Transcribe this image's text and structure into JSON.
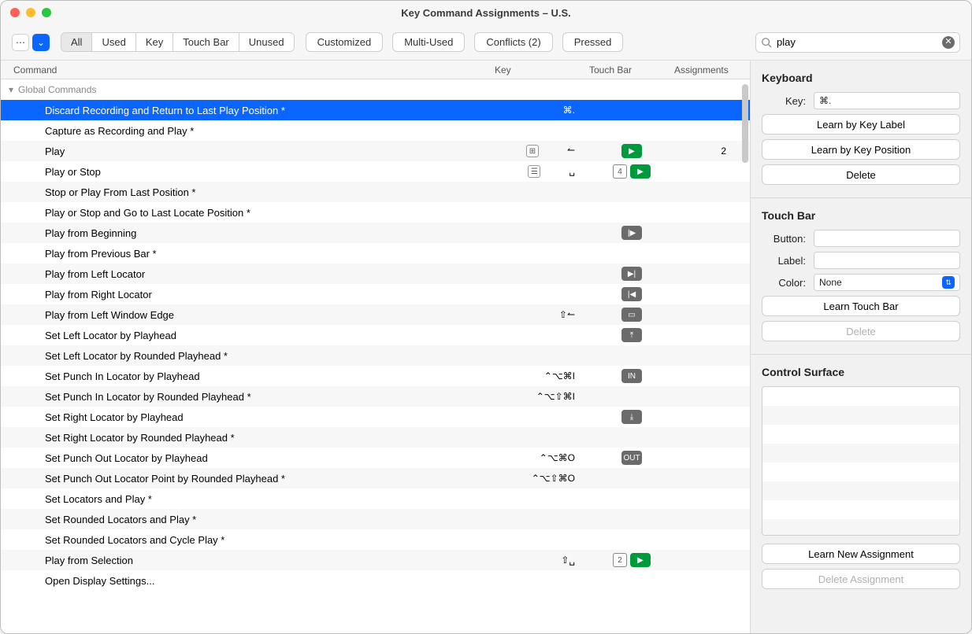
{
  "window": {
    "title": "Key Command Assignments – U.S."
  },
  "toolbar": {
    "segments": [
      "All",
      "Used",
      "Key",
      "Touch Bar",
      "Unused"
    ],
    "pills": [
      "Customized",
      "Multi-Used",
      "Conflicts (2)",
      "Pressed"
    ]
  },
  "search": {
    "value": "play",
    "placeholder": ""
  },
  "headers": {
    "command": "Command",
    "key": "Key",
    "touchbar": "Touch Bar",
    "assignments": "Assignments"
  },
  "group": {
    "label": "Global Commands"
  },
  "rows": [
    {
      "cmd": "Discard Recording and Return to Last Play Position *",
      "key": "⌘.",
      "tb": [],
      "asg": "",
      "selected": true
    },
    {
      "cmd": "Capture as Recording and Play *",
      "key": "",
      "tb": [],
      "asg": ""
    },
    {
      "cmd": "Play",
      "key": "⊞",
      "key_arrow": "↼",
      "tb": [
        {
          "t": "green",
          "g": "▶"
        }
      ],
      "asg": "2"
    },
    {
      "cmd": "Play or Stop",
      "key": "☰",
      "key_arrow": "␣",
      "tb": [
        {
          "t": "box",
          "g": "4"
        },
        {
          "t": "green",
          "g": "▶"
        }
      ],
      "asg": ""
    },
    {
      "cmd": "Stop or Play From Last Position *",
      "key": "",
      "tb": [],
      "asg": ""
    },
    {
      "cmd": "Play or Stop and Go to Last Locate Position *",
      "key": "",
      "tb": [],
      "asg": ""
    },
    {
      "cmd": "Play from Beginning",
      "key": "",
      "tb": [
        {
          "t": "gray",
          "g": "|▶"
        }
      ],
      "asg": ""
    },
    {
      "cmd": "Play from Previous Bar *",
      "key": "",
      "tb": [],
      "asg": ""
    },
    {
      "cmd": "Play from Left Locator",
      "key": "",
      "tb": [
        {
          "t": "gray",
          "g": "▶|"
        }
      ],
      "asg": ""
    },
    {
      "cmd": "Play from Right Locator",
      "key": "",
      "tb": [
        {
          "t": "gray",
          "g": "|◀"
        }
      ],
      "asg": ""
    },
    {
      "cmd": "Play from Left Window Edge",
      "key": "⇧↼",
      "tb": [
        {
          "t": "gray",
          "g": "▭"
        }
      ],
      "asg": ""
    },
    {
      "cmd": "Set Left Locator by Playhead",
      "key": "",
      "tb": [
        {
          "t": "gray",
          "g": "⤒"
        }
      ],
      "asg": ""
    },
    {
      "cmd": "Set Left Locator by Rounded Playhead *",
      "key": "",
      "tb": [],
      "asg": ""
    },
    {
      "cmd": "Set Punch In Locator by Playhead",
      "key": "⌃⌥⌘I",
      "tb": [
        {
          "t": "gray",
          "g": "IN"
        }
      ],
      "asg": ""
    },
    {
      "cmd": "Set Punch In Locator by Rounded Playhead *",
      "key": "⌃⌥⇧⌘I",
      "tb": [],
      "asg": ""
    },
    {
      "cmd": "Set Right Locator by Playhead",
      "key": "",
      "tb": [
        {
          "t": "gray",
          "g": "⤓"
        }
      ],
      "asg": ""
    },
    {
      "cmd": "Set Right Locator by Rounded Playhead *",
      "key": "",
      "tb": [],
      "asg": ""
    },
    {
      "cmd": "Set Punch Out Locator by Playhead",
      "key": "⌃⌥⌘O",
      "tb": [
        {
          "t": "gray",
          "g": "OUT"
        }
      ],
      "asg": ""
    },
    {
      "cmd": "Set Punch Out Locator Point by Rounded Playhead *",
      "key": "⌃⌥⇧⌘O",
      "tb": [],
      "asg": ""
    },
    {
      "cmd": "Set Locators and Play *",
      "key": "",
      "tb": [],
      "asg": ""
    },
    {
      "cmd": "Set Rounded Locators and Play *",
      "key": "",
      "tb": [],
      "asg": ""
    },
    {
      "cmd": "Set Rounded Locators and Cycle Play *",
      "key": "",
      "tb": [],
      "asg": ""
    },
    {
      "cmd": "Play from Selection",
      "key": "⇧␣",
      "tb": [
        {
          "t": "box",
          "g": "2"
        },
        {
          "t": "green",
          "g": "▶"
        }
      ],
      "asg": ""
    },
    {
      "cmd": "Open Display Settings...",
      "key": "",
      "tb": [],
      "asg": ""
    }
  ],
  "side": {
    "keyboard": {
      "title": "Keyboard",
      "key_label": "Key:",
      "key_value": "⌘.",
      "learn_label": "Learn by Key Label",
      "learn_position": "Learn by Key Position",
      "delete": "Delete"
    },
    "touchbar": {
      "title": "Touch Bar",
      "button_label": "Button:",
      "button_value": "",
      "label_label": "Label:",
      "label_value": "",
      "color_label": "Color:",
      "color_value": "None",
      "learn": "Learn Touch Bar",
      "delete": "Delete"
    },
    "surface": {
      "title": "Control Surface",
      "learn": "Learn New Assignment",
      "delete": "Delete Assignment"
    }
  }
}
